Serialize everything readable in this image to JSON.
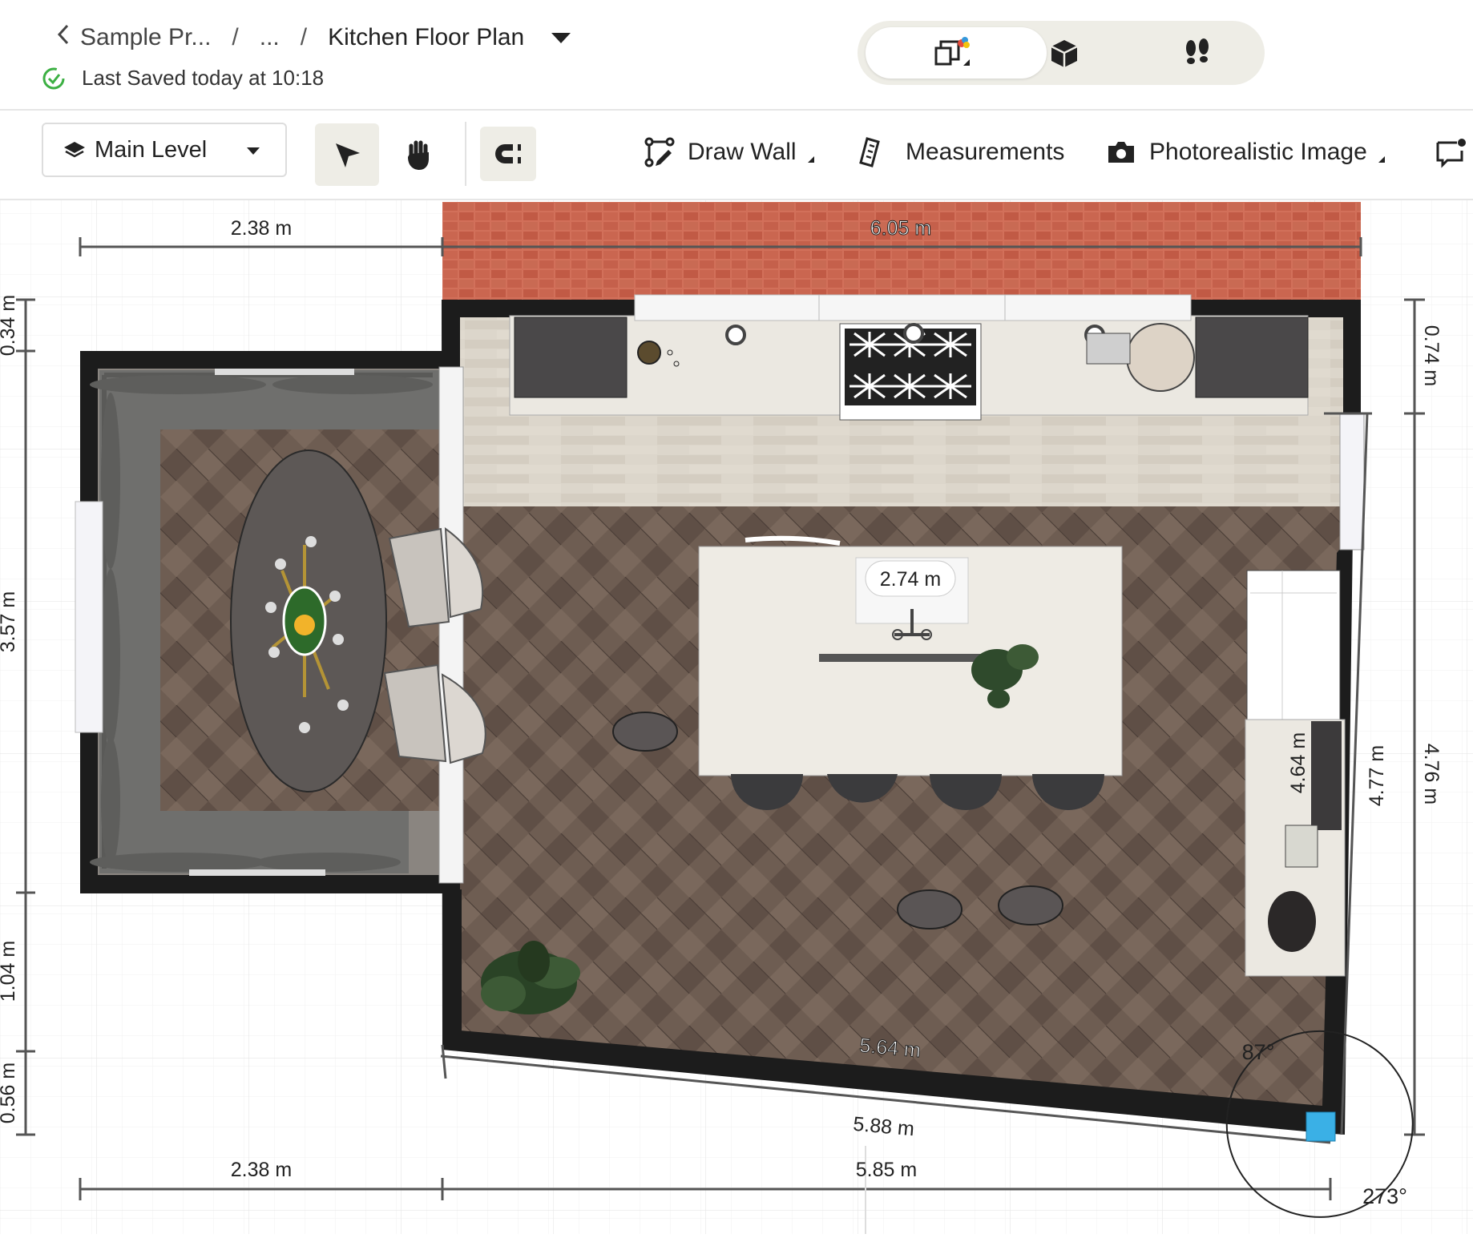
{
  "header": {
    "breadcrumb": {
      "project": "Sample Pr...",
      "ellipsis": "...",
      "separator": "/",
      "current": "Kitchen Floor Plan"
    },
    "save_status": "Last Saved today at 10:18",
    "view_modes": [
      {
        "name": "2D",
        "icon": "floorplan-2d-icon",
        "active": true
      },
      {
        "name": "3D",
        "icon": "cube-3d-icon",
        "active": false
      },
      {
        "name": "Walkthrough",
        "icon": "footsteps-icon",
        "active": false
      }
    ]
  },
  "toolbar": {
    "level_selector": "Main Level",
    "tools": [
      {
        "name": "select",
        "icon": "cursor-arrow-icon",
        "active": true
      },
      {
        "name": "pan",
        "icon": "hand-icon",
        "active": false
      },
      {
        "name": "snap",
        "icon": "magnet-icon",
        "active": true
      }
    ],
    "draw_wall": "Draw Wall",
    "measurements": "Measurements",
    "photorealistic": "Photorealistic Image"
  },
  "plan": {
    "dimensions": {
      "top_left": "2.38 m",
      "top_main": "6.05 m",
      "left_1": "0.34 m",
      "left_2": "3.57 m",
      "left_3": "1.04 m",
      "left_4": "0.56 m",
      "right_outer_1": "0.74 m",
      "right_outer_2": "4.76 m",
      "right_inner": "4.77 m",
      "island_width": "2.74 m",
      "counter_depth": "4.64 m",
      "bottom_inner": "5.64 m",
      "bottom_wall": "5.88 m",
      "bottom_left": "2.38 m",
      "bottom_right": "5.85 m"
    },
    "angles": {
      "corner_inner": "87°",
      "corner_outer": "273°"
    },
    "colors": {
      "wall": "#1c1c1c",
      "brick": "#c1604b",
      "wood": "#6b5a4f",
      "counter": "#ebe8e1",
      "selection": "#3ab0e6"
    }
  }
}
